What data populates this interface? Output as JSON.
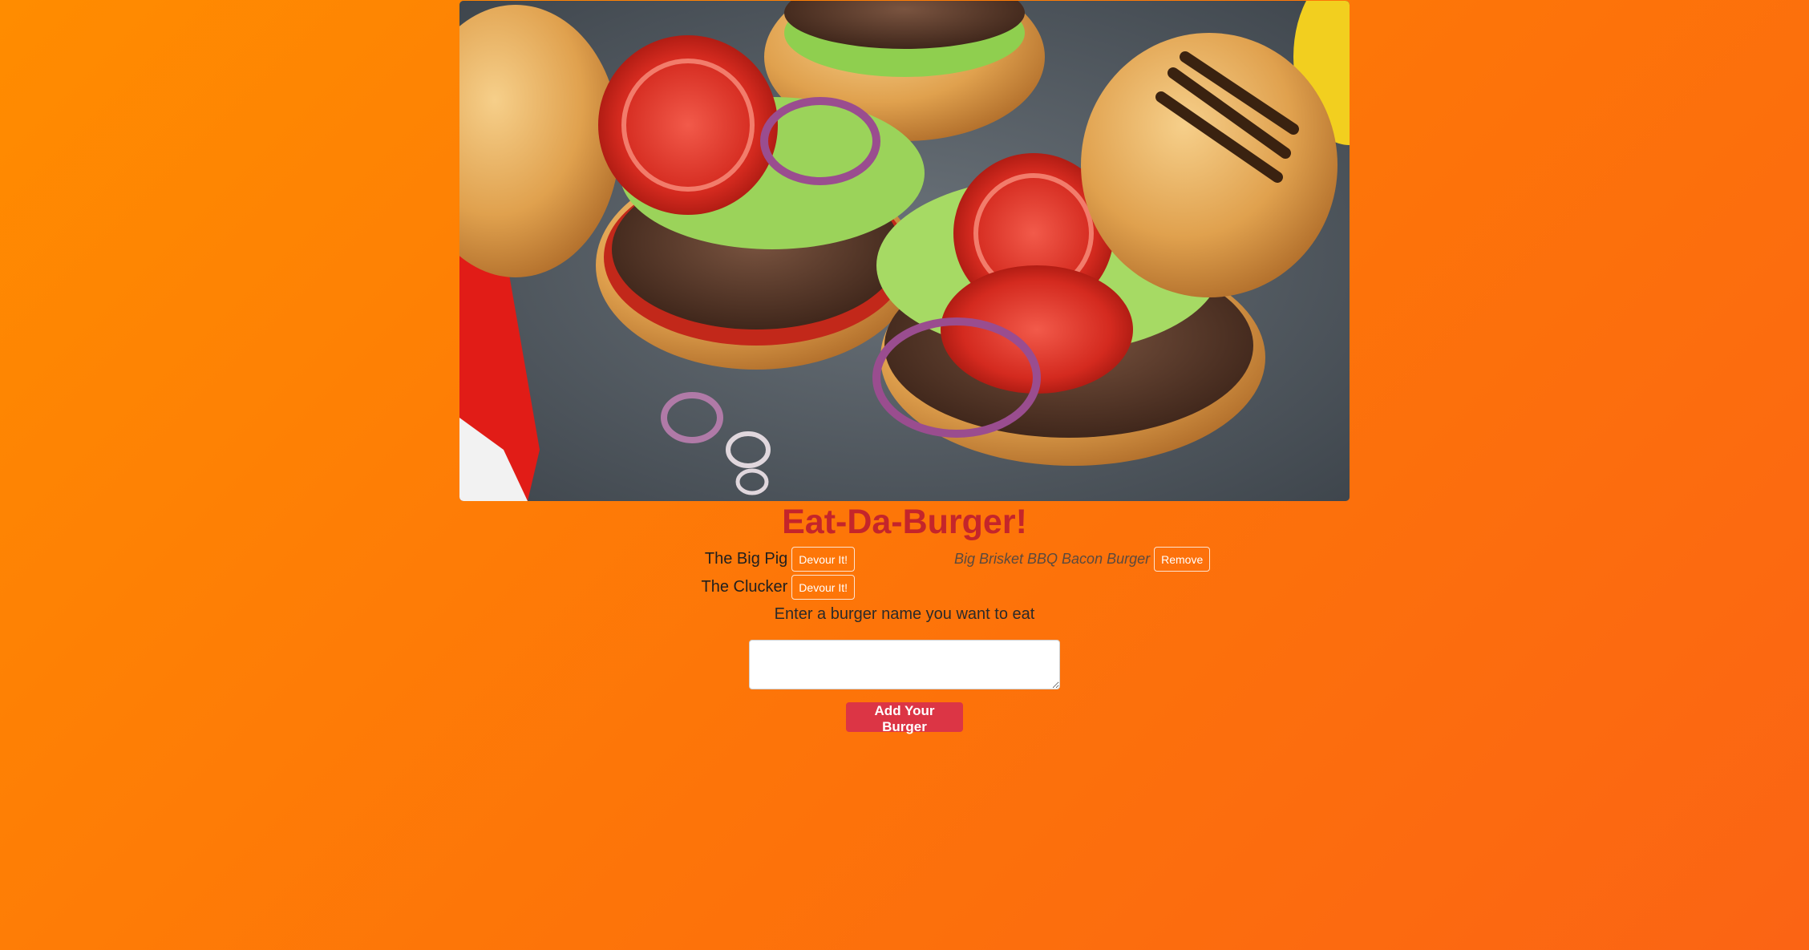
{
  "page": {
    "title": "Eat-Da-Burger!",
    "hero_image": "burgers-photo"
  },
  "uneaten_burgers": [
    {
      "name": "The Big Pig",
      "button_label": "Devour It!"
    },
    {
      "name": "The Clucker",
      "button_label": "Devour It!"
    }
  ],
  "devoured_burgers": [
    {
      "name": "Big Brisket BBQ Bacon Burger",
      "button_label": "Remove"
    }
  ],
  "form": {
    "prompt": "Enter a burger name you want to eat",
    "input_value": "",
    "submit_label": "Add Your Burger"
  },
  "colors": {
    "background_start": "#ff8c00",
    "background_end": "#fb6414",
    "title": "#c4252b",
    "submit_button": "#dc3545"
  }
}
